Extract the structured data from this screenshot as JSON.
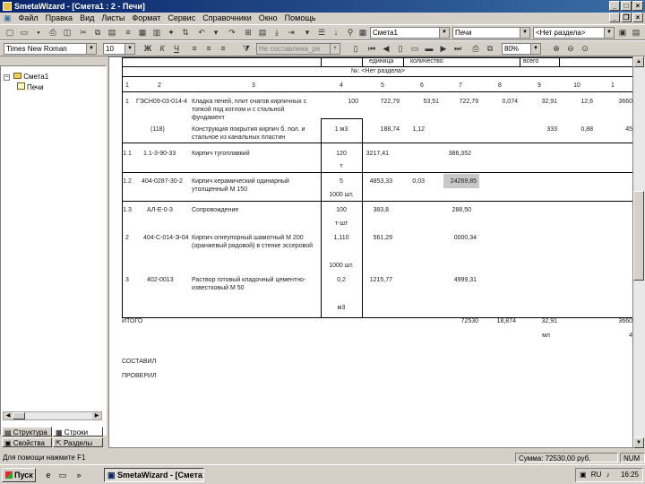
{
  "window": {
    "title": "SmetaWizard - [Смета1 : 2 - Печи]"
  },
  "menu": [
    "Файл",
    "Правка",
    "Вид",
    "Листы",
    "Формат",
    "Сервис",
    "Справочники",
    "Окно",
    "Помощь"
  ],
  "toolbar1": {
    "combo_smeta": "Смета1",
    "combo_section": "Печи",
    "combo_razdel": "<Нет раздела>"
  },
  "toolbar2": {
    "font_name": "Times New Roman",
    "font_size": "10",
    "style_combo": "Не составлена_ре",
    "zoom": "80%"
  },
  "tree": {
    "root": "Смета1",
    "child": "Печи"
  },
  "left_tabs": {
    "structure": "Структура",
    "rows": "Строки",
    "properties": "Свойства",
    "sections": "Разделы"
  },
  "sheet": {
    "header_partial": [
      "единица",
      "количество",
      "всего"
    ],
    "section_header": "№: <Нет раздела>",
    "column_numbers": [
      "1",
      "2",
      "3",
      "4",
      "5",
      "6",
      "7",
      "8",
      "9",
      "10",
      "1"
    ],
    "rows": [
      {
        "num": "1",
        "code": "ГЭСН09-03-014-4",
        "desc": "Кладка печей, плит очагов кирпичных с топкой под котлом и с стальной фундамент",
        "qty": "100",
        "price": "722,79",
        "wage": "53,51",
        "total": "722,79",
        "c8": "0,074",
        "c9": "32,91",
        "c10": "12,6",
        "c11": "3660"
      },
      {
        "num": "",
        "code": "(118)",
        "desc": "Конструкция покрытия кирпич б. пол. и стальное из канальных пластин",
        "qty": "1 м3",
        "price": "188,74",
        "wage": "1,12",
        "total": "",
        "c8": "",
        "c9": "333",
        "c10": "0,88",
        "c11": "45"
      },
      {
        "num": "1.1",
        "code": "1.1-3-90-33",
        "desc": "Кирпич тугоплавкий",
        "qty": "120",
        "qty2": "т",
        "price": "3217,41",
        "wage": "",
        "total": "386,352"
      },
      {
        "num": "1.2",
        "code": "404-0287-30-2",
        "desc": "Кирпич керамический одинарный утолщенный М 150",
        "qty": "5",
        "qty2": "1000 шт.",
        "price": "4853,33",
        "wage": "0,03",
        "total": "24269,85"
      },
      {
        "num": "1.3",
        "code": "АЛ-Е-0-3",
        "desc": "Сопровождение",
        "qty": "100",
        "qty2": "т-шт",
        "price": "383,8",
        "wage": "",
        "total": "288,50"
      },
      {
        "num": "2",
        "code": "404-С-014-Э-04",
        "desc": "Кирпич огнеупорный шамотный М 200 (оранжевый рядовой) в стенке эссеровой",
        "qty": "1,110",
        "qty2": "1000 шт.",
        "price": "561,29",
        "wage": "",
        "total": "0000,34"
      },
      {
        "num": "3",
        "code": "402-0013",
        "desc": "Раствор готовый кладочный цементно-известковый М 50",
        "qty": "0,2",
        "qty2": "м3",
        "price": "1215,77",
        "wage": "",
        "total": "4999,31"
      }
    ],
    "itogo_label": "ИТОГО",
    "itogo": {
      "c7": "72530",
      "c8": "18,874",
      "c9": "32,91",
      "c11": "3660"
    },
    "itogo_sub": {
      "c9": "мл",
      "c11": "4"
    },
    "sostavil": "СОСТАВИЛ",
    "proveril": "ПРОВЕРИЛ"
  },
  "status": {
    "hint": "Для помощи нажмите F1",
    "sum": "Сумма: 72530,00 руб.",
    "num": "NUM"
  },
  "taskbar": {
    "start": "Пуск",
    "task": "SmetaWizard - [Смета1...",
    "lang": "RU",
    "clock": "16:25"
  }
}
